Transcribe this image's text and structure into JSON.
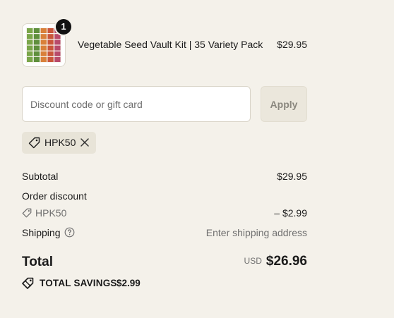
{
  "product": {
    "quantity": "1",
    "title": "Vegetable Seed Vault Kit | 35 Variety Pack",
    "price": "$29.95",
    "thumbnail_icon": "seed-packets-image"
  },
  "discount": {
    "placeholder": "Discount code or gift card",
    "value": "",
    "apply_label": "Apply"
  },
  "applied_code": {
    "code": "HPK50",
    "tag_icon": "tag-icon",
    "remove_icon": "close-icon"
  },
  "summary": {
    "subtotal_label": "Subtotal",
    "subtotal_value": "$29.95",
    "order_discount_label": "Order discount",
    "discount_code": "HPK50",
    "discount_value": "– $2.99",
    "shipping_label": "Shipping",
    "shipping_value": "Enter shipping address",
    "total_label": "Total",
    "currency": "USD",
    "total_value": "$26.96",
    "savings_label": "TOTAL SAVINGS",
    "savings_value": "$2.99"
  },
  "colors": {
    "background": "#f4f1ea",
    "text": "#1b1b1b",
    "muted": "#707070",
    "chip": "#e8e4d8",
    "button_disabled": "#ebe7dc"
  }
}
